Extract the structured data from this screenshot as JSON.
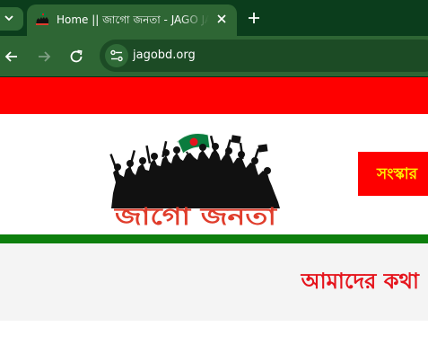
{
  "browser": {
    "tab": {
      "title": "Home || জাগো জনতা - JAGO JANATA",
      "favicon": "jago-janata-logo-icon"
    },
    "address_bar": {
      "url": "jagobd.org",
      "site_info_icon": "tune-icon"
    },
    "icons": {
      "tab_search": "chevron-down-icon",
      "close": "close-icon",
      "new_tab": "plus-icon",
      "back": "arrow-left-icon",
      "forward": "arrow-right-icon",
      "reload": "reload-icon"
    },
    "colors": {
      "tab_strip": "#0b3d1c",
      "toolbar": "#2e6634",
      "omnibox": "#1c4b25"
    }
  },
  "site": {
    "logo": {
      "text": "জাগো জনতা",
      "text_color": "#e03d2c",
      "flag_green": "#0a7c3e",
      "flag_red": "#e5141c"
    },
    "header_button": {
      "label": "সংস্কার"
    },
    "about": {
      "heading": "আমাদের কথা"
    },
    "colors": {
      "top_bar": "#fe0000",
      "divider_bar": "#0d7f0d",
      "button_bg": "#fe0000",
      "button_text": "#ffee00",
      "heading": "#e5141c",
      "section_bg": "#f4f4f4"
    }
  }
}
